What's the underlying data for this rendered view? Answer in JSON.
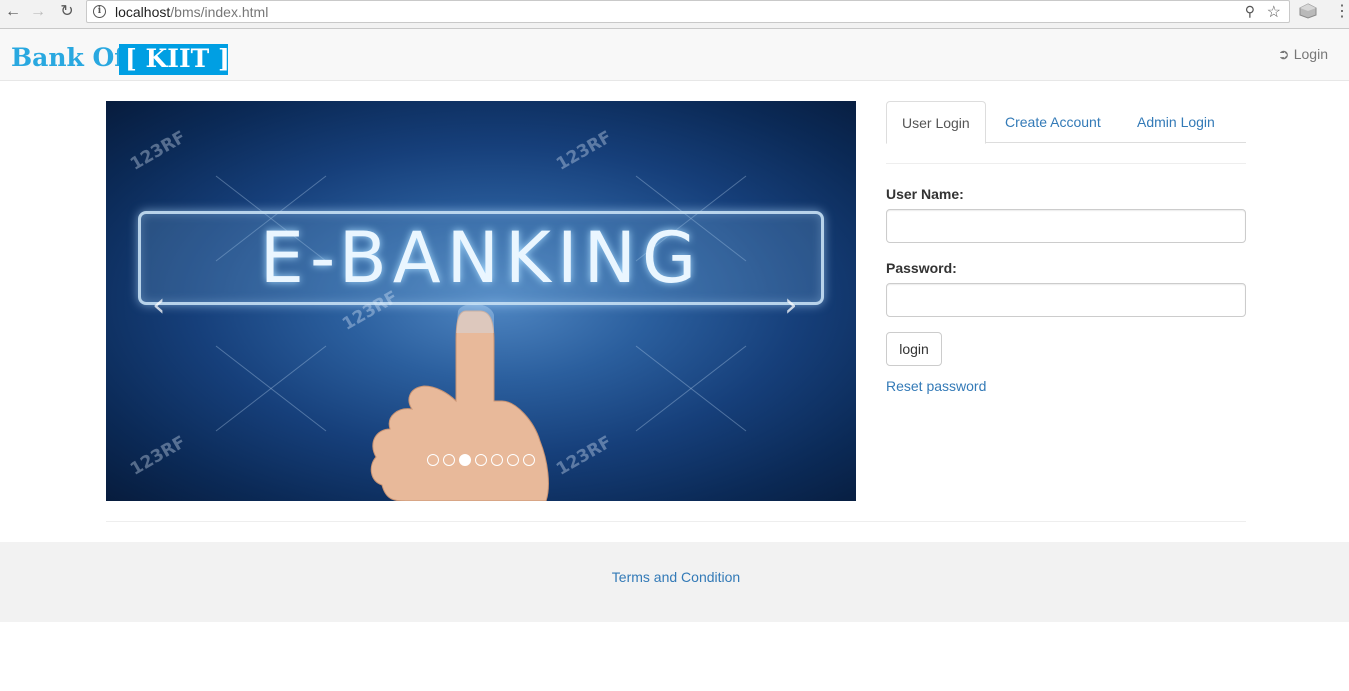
{
  "browser": {
    "url_host": "localhost",
    "url_path": "/bms/index.html",
    "icons": [
      "back-arrow-icon",
      "forward-arrow-icon",
      "reload-icon",
      "info-icon",
      "key-icon",
      "star-icon",
      "extension-icon",
      "menu-dots-icon"
    ]
  },
  "navbar": {
    "brand_prefix": "Bank Of",
    "brand_highlight": "[ KIIT ]",
    "login_label": "Login",
    "brand_color": "#29a8e0",
    "brand_box_color": "#009fe3"
  },
  "carousel": {
    "banner_text": "E-BANKING",
    "watermark": "123RF",
    "prev_glyph": "‹",
    "next_glyph": "›",
    "slide_count": 7,
    "active_index": 2
  },
  "login_panel": {
    "tabs": [
      {
        "label": "User Login",
        "active": true
      },
      {
        "label": "Create Account",
        "active": false
      },
      {
        "label": "Admin Login",
        "active": false
      }
    ],
    "username_label": "User Name:",
    "username_value": "",
    "password_label": "Password:",
    "password_value": "",
    "submit_label": "login",
    "reset_label": "Reset password",
    "link_color": "#337ab7"
  },
  "footer": {
    "terms_label": "Terms and Condition"
  }
}
